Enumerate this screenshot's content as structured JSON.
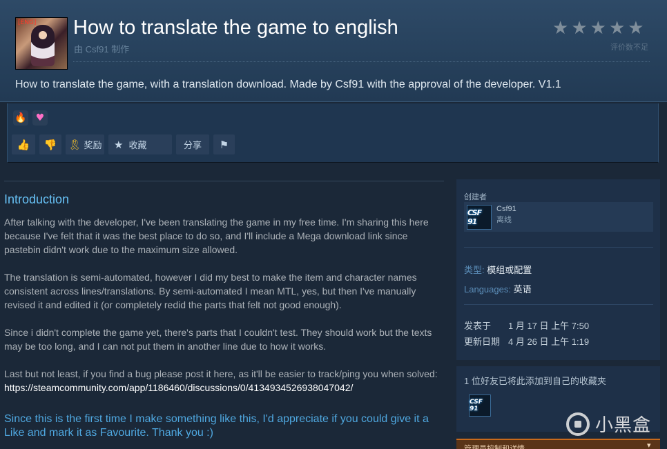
{
  "header": {
    "thumbnail_tag": "[ENG]",
    "title": "How to translate the game to english",
    "author_line": "由 Csf91 制作",
    "rating_text": "评价数不足",
    "description": "How to translate the game, with a translation download. Made by Csf91 with the approval of the developer. V1.1"
  },
  "toolbar": {
    "award_label": "奖励",
    "favorite_label": "收藏",
    "share_label": "分享"
  },
  "content": {
    "section_title": "Introduction",
    "paragraph1": "After talking with the developer, I've been translating the game in my free time. I'm sharing this here because I've felt that it was the best place to do so, and I'll include a Mega download link since pastebin didn't work due to the maximum size allowed.",
    "paragraph2": "The translation is semi-automated, however I did my best to make the item and character names consistent across lines/translations. By semi-automated I mean MTL, yes, but then I've manually revised it and edited it (or completely redid the parts that felt not good enough).",
    "paragraph3": "Since i didn't complete the game yet, there's parts that I couldn't test. They should work but the texts may be too long, and I can not put them in another line due to how it works.",
    "paragraph4_text": "Last but not least, if you find a bug please post it here, as it'll be easier to track/ping you when solved: ",
    "paragraph4_link": "https://steamcommunity.com/app/1186460/discussions/0/4134934526938047042/",
    "highlight": "Since this is the first time I make something like this, I'd appreciate if you could give it a Like and mark it as Favourite. Thank you :)"
  },
  "sidebar": {
    "creator_label": "创建者",
    "creator_name": "Csf91",
    "creator_status": "离线",
    "avatar_mark": "CSF 91",
    "type_key": "类型:",
    "type_value": "模组或配置",
    "languages_key": "Languages:",
    "languages_value": "英语",
    "posted_key": "发表于",
    "posted_value": "1 月 17 日 上午 7:50",
    "updated_key": "更新日期",
    "updated_value": "4 月 26 日 上午 1:19",
    "friends_text": "1 位好友已将此添加到自己的收藏夹",
    "admin_label": "管理员控制和详情"
  },
  "watermark": {
    "text": "小黑盒"
  },
  "colors": {
    "background": "#1b2838",
    "link_blue": "#67c1f5",
    "thumbs_up_green": "#6cb33e"
  }
}
